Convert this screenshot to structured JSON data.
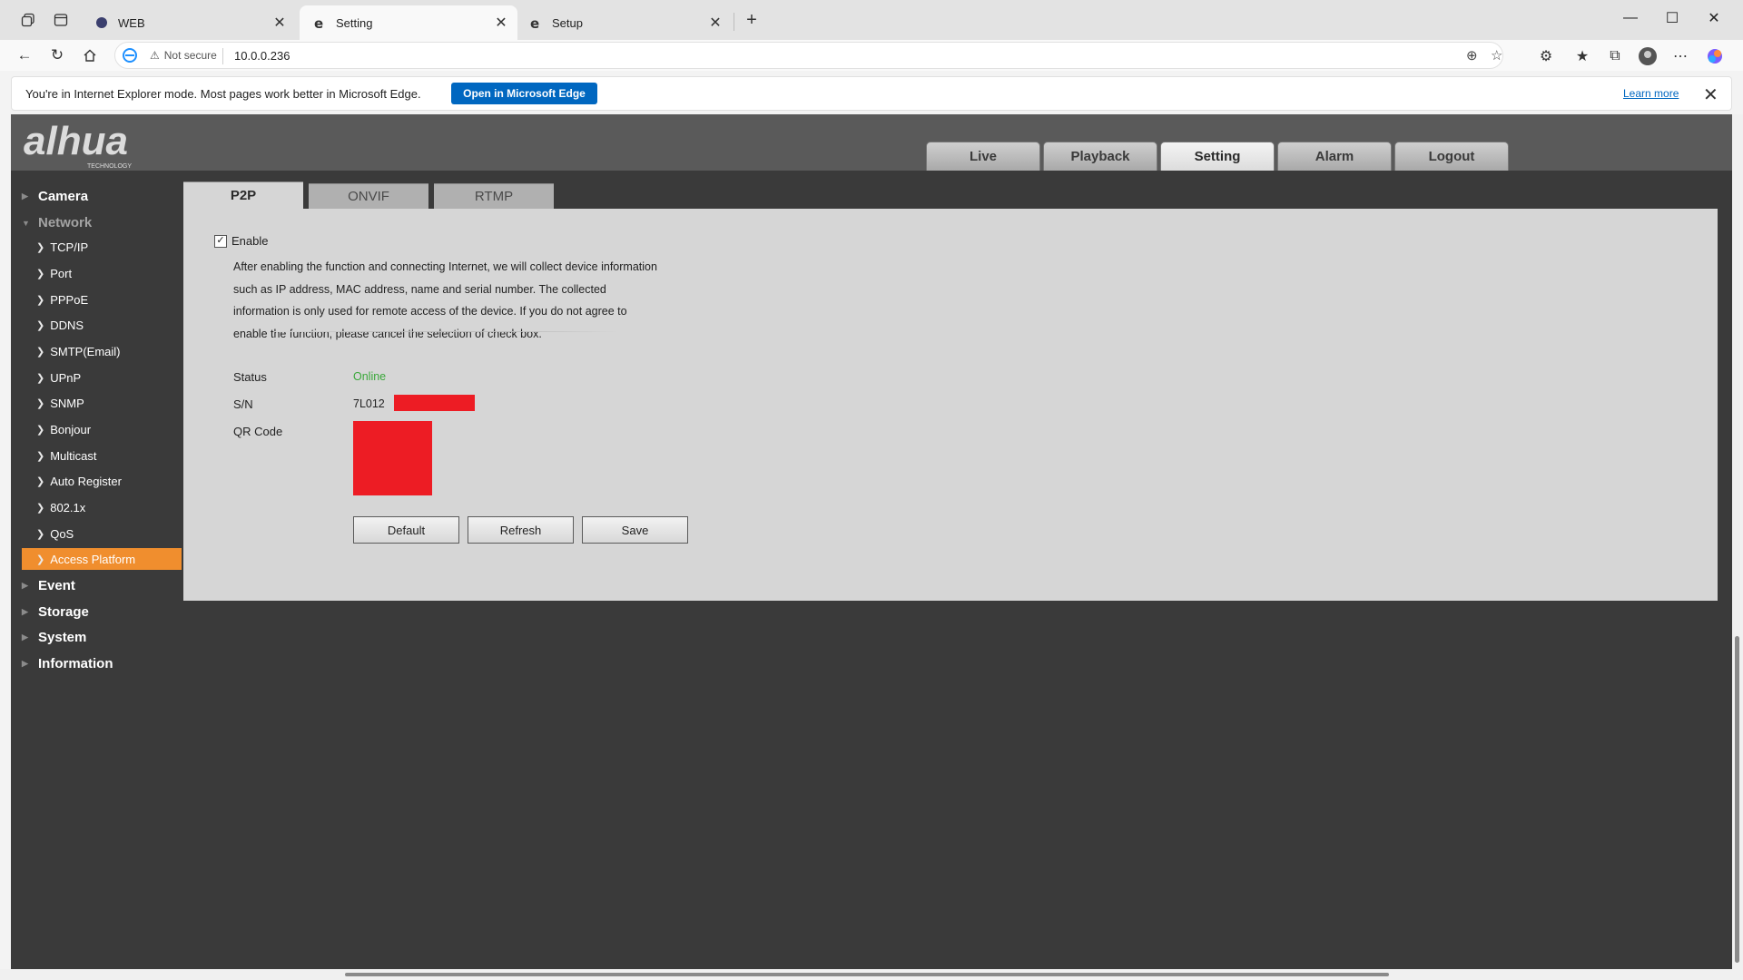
{
  "browser": {
    "tabs": [
      {
        "title": "WEB",
        "active": false
      },
      {
        "title": "Setting",
        "active": true
      },
      {
        "title": "Setup",
        "active": false
      }
    ],
    "address": {
      "security": "Not secure",
      "url": "10.0.0.236"
    },
    "ie_mode_bar": {
      "message": "You're in Internet Explorer mode. Most pages work better in Microsoft Edge.",
      "open_button": "Open in Microsoft Edge",
      "learn_more": "Learn more"
    }
  },
  "app": {
    "logo": {
      "brand": "alhua",
      "sub": "TECHNOLOGY"
    },
    "top_nav": [
      {
        "label": "Live",
        "active": false
      },
      {
        "label": "Playback",
        "active": false
      },
      {
        "label": "Setting",
        "active": true
      },
      {
        "label": "Alarm",
        "active": false
      },
      {
        "label": "Logout",
        "active": false
      }
    ],
    "sidebar": {
      "groups": {
        "camera": "Camera",
        "network": "Network",
        "event": "Event",
        "storage": "Storage",
        "system": "System",
        "information": "Information"
      },
      "network_items": [
        "TCP/IP",
        "Port",
        "PPPoE",
        "DDNS",
        "SMTP(Email)",
        "UPnP",
        "SNMP",
        "Bonjour",
        "Multicast",
        "Auto Register",
        "802.1x",
        "QoS",
        "Access Platform"
      ],
      "active_item": "Access Platform"
    },
    "content_tabs": [
      {
        "label": "P2P",
        "active": true
      },
      {
        "label": "ONVIF",
        "active": false
      },
      {
        "label": "RTMP",
        "active": false
      }
    ],
    "p2p": {
      "enable_label": "Enable",
      "enabled": true,
      "description": [
        "After enabling the function and connecting Internet, we will collect device information",
        "such as IP address, MAC address, name and serial number. The collected",
        "information is only used for remote access of the device. If you do not agree to",
        "enable the function, please cancel the selection of check box."
      ],
      "status_label": "Status",
      "status_value": "Online",
      "sn_label": "S/N",
      "sn_value": "7L012",
      "qr_label": "QR Code",
      "buttons": {
        "default": "Default",
        "refresh": "Refresh",
        "save": "Save"
      }
    }
  },
  "colors": {
    "active_item": "#f08e2e",
    "online": "#3aa83a",
    "redaction": "#ed1c24",
    "edge_blue": "#0067c0"
  }
}
